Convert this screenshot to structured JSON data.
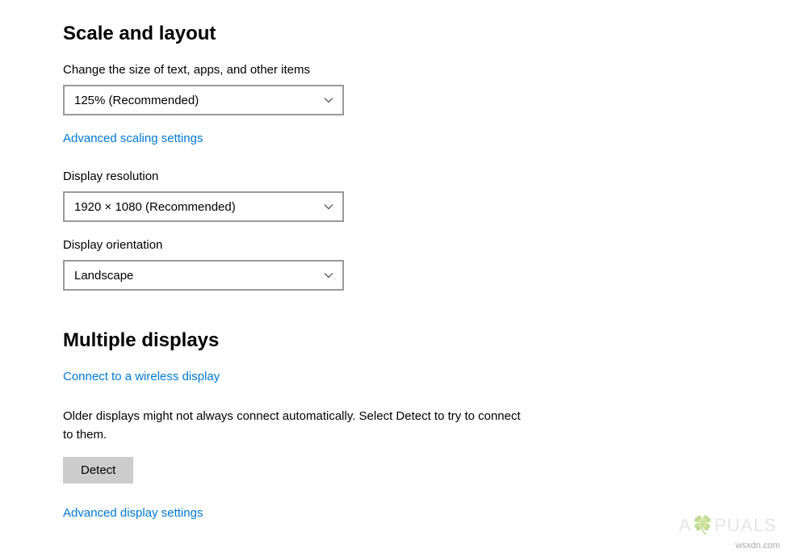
{
  "scale_layout": {
    "heading": "Scale and layout",
    "text_size_label": "Change the size of text, apps, and other items",
    "text_size_value": "125% (Recommended)",
    "advanced_scaling_link": "Advanced scaling settings",
    "resolution_label": "Display resolution",
    "resolution_value": "1920 × 1080 (Recommended)",
    "orientation_label": "Display orientation",
    "orientation_value": "Landscape"
  },
  "multiple_displays": {
    "heading": "Multiple displays",
    "wireless_link": "Connect to a wireless display",
    "description": "Older displays might not always connect automatically. Select Detect to try to connect to them.",
    "detect_button": "Detect",
    "advanced_link": "Advanced display settings"
  },
  "watermark": {
    "site": "wsxdn.com"
  }
}
